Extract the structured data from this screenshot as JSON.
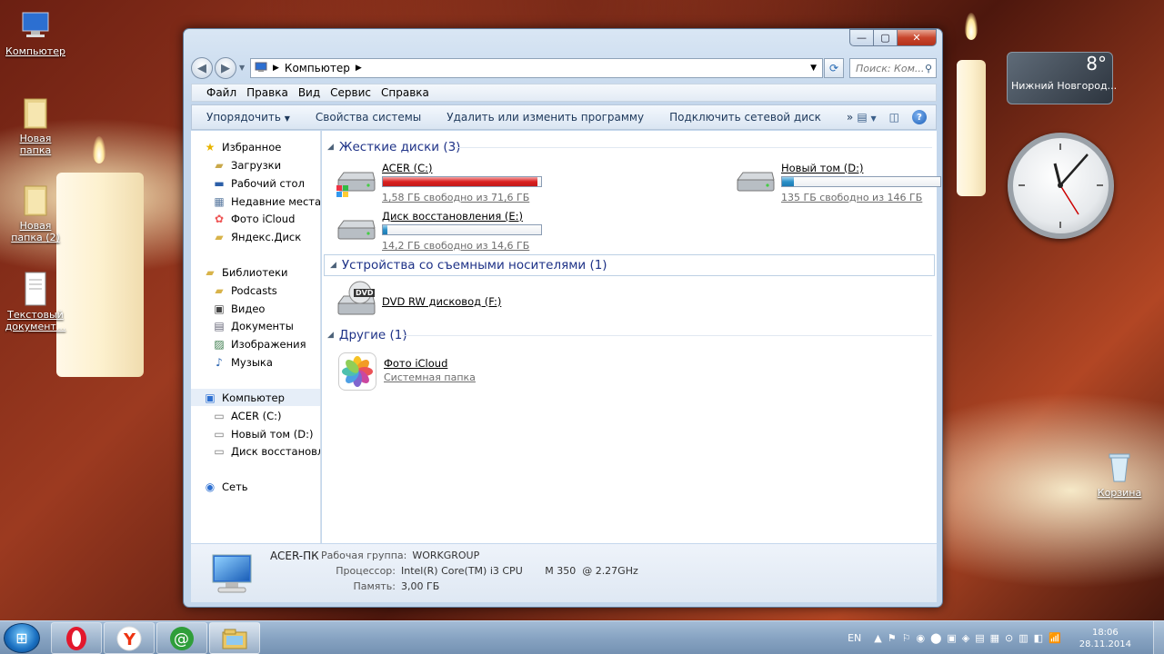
{
  "desktop": {
    "icons": [
      {
        "label": "Компьютер",
        "icon": "computer-icon"
      },
      {
        "label": "Новая папка",
        "icon": "folder-icon"
      },
      {
        "label": "Новая папка (2)",
        "icon": "folder-icon"
      },
      {
        "label": "Текстовый документ...",
        "icon": "text-document-icon"
      },
      {
        "label": "Корзина",
        "icon": "recycle-bin-icon"
      }
    ],
    "weather": {
      "temp": "8°",
      "city": "Нижний Новгород..."
    }
  },
  "window": {
    "address": {
      "crumb": "Компьютер"
    },
    "search_placeholder": "Поиск: Ком...",
    "menu": [
      "Файл",
      "Правка",
      "Вид",
      "Сервис",
      "Справка"
    ],
    "commands": [
      "Упорядочить",
      "Свойства системы",
      "Удалить или изменить программу",
      "Подключить сетевой диск"
    ],
    "nav": {
      "favorites_title": "Избранное",
      "favorites": [
        "Загрузки",
        "Рабочий стол",
        "Недавние места",
        "Фото iCloud",
        "Яндекс.Диск"
      ],
      "libraries_title": "Библиотеки",
      "libraries": [
        "Podcasts",
        "Видео",
        "Документы",
        "Изображения",
        "Музыка"
      ],
      "computer_title": "Компьютер",
      "computer": [
        "ACER (C:)",
        "Новый том (D:)",
        "Диск восстановле"
      ],
      "network_title": "Сеть"
    },
    "groups": {
      "hdd": "Жесткие диски (3)",
      "removable": "Устройства со съемными носителями (1)",
      "other": "Другие (1)"
    },
    "drives": [
      {
        "name": "ACER (C:)",
        "free": "1,58 ГБ свободно из 71,6 ГБ",
        "used_fraction": 0.978,
        "color": "#d82020"
      },
      {
        "name": "Новый том (D:)",
        "free": "135 ГБ свободно из 146 ГБ",
        "used_fraction": 0.075,
        "color": "#2b90c8"
      },
      {
        "name": "Диск восстановления (E:)",
        "free": "14,2 ГБ свободно из 14,6 ГБ",
        "used_fraction": 0.027,
        "color": "#2b90c8"
      }
    ],
    "removable": {
      "name": "DVD RW дисковод (F:)",
      "badge": "DVD"
    },
    "other": {
      "name": "Фото iCloud",
      "sub": "Системная папка"
    },
    "details": {
      "pc_name": "ACER-ПК",
      "workgroup_key": "Рабочая группа:",
      "workgroup": "WORKGROUP",
      "cpu_key": "Процессор:",
      "cpu": "Intel(R) Core(TM) i3 CPU       M 350  @ 2.27GHz",
      "ram_key": "Память:",
      "ram": "3,00 ГБ"
    }
  },
  "taskbar": {
    "lang": "EN",
    "time": "18:06",
    "date": "28.11.2014"
  }
}
